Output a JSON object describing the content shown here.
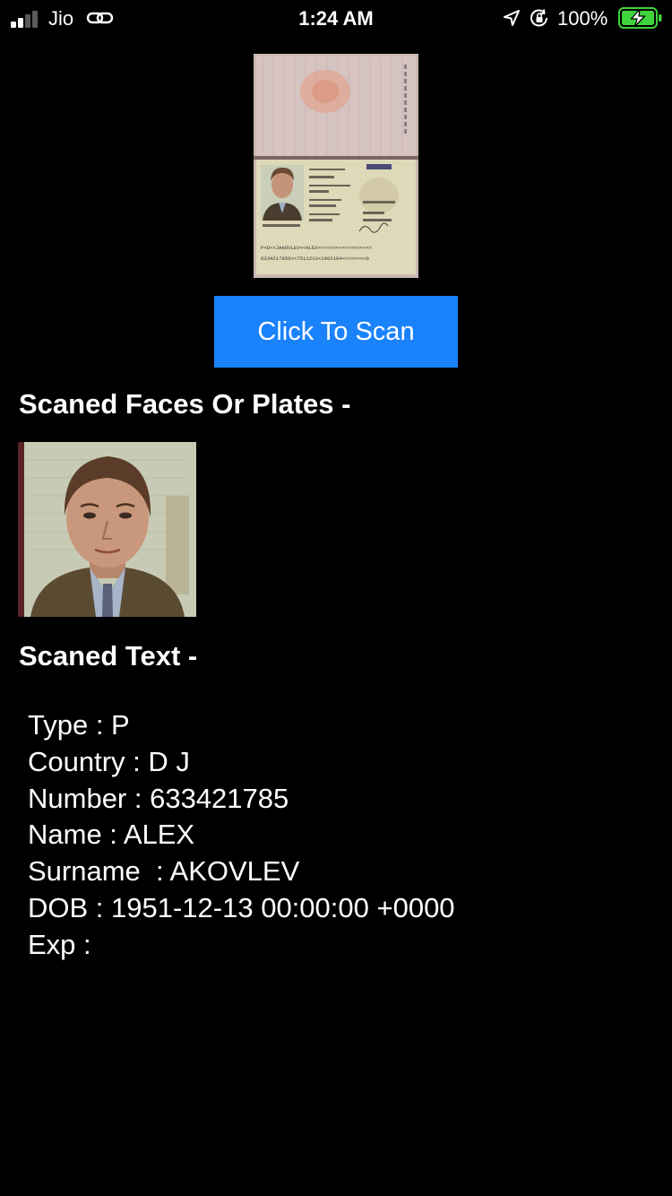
{
  "status_bar": {
    "carrier": "Jio",
    "time": "1:24 AM",
    "battery_percent": "100%",
    "signal_bars_filled": 2,
    "signal_bars_total": 4,
    "battery_level_percent": 100,
    "battery_charging": true,
    "icons": [
      "signal-icon",
      "link-icon",
      "location-arrow-icon",
      "rotation-lock-icon",
      "battery-charging-icon"
    ],
    "colors": {
      "battery_fill": "#3fd33c",
      "signal_off": "#5a5a5a"
    }
  },
  "document_preview": {
    "mrz_line_1": "P<D<<JAKOVLEV<<ALEX<<<<<<<<<<<<<<<<<<",
    "mrz_line_2": "6334217850<<7511213<1902194<<<<<<<<0"
  },
  "scan_button": {
    "label": "Click To Scan",
    "color": "#1a82fb"
  },
  "faces_section": {
    "heading": "Scaned Faces Or Plates -"
  },
  "text_section": {
    "heading": "Scaned Text -",
    "fields": [
      {
        "label": "Type : P"
      },
      {
        "label": "Country : D J"
      },
      {
        "label": "Number : 633421785"
      },
      {
        "label": "Name : ALEX"
      },
      {
        "label": "Surname  : AKOVLEV"
      },
      {
        "label": "DOB : 1951-12-13 00:00:00 +0000"
      },
      {
        "label": "Exp :"
      }
    ]
  }
}
